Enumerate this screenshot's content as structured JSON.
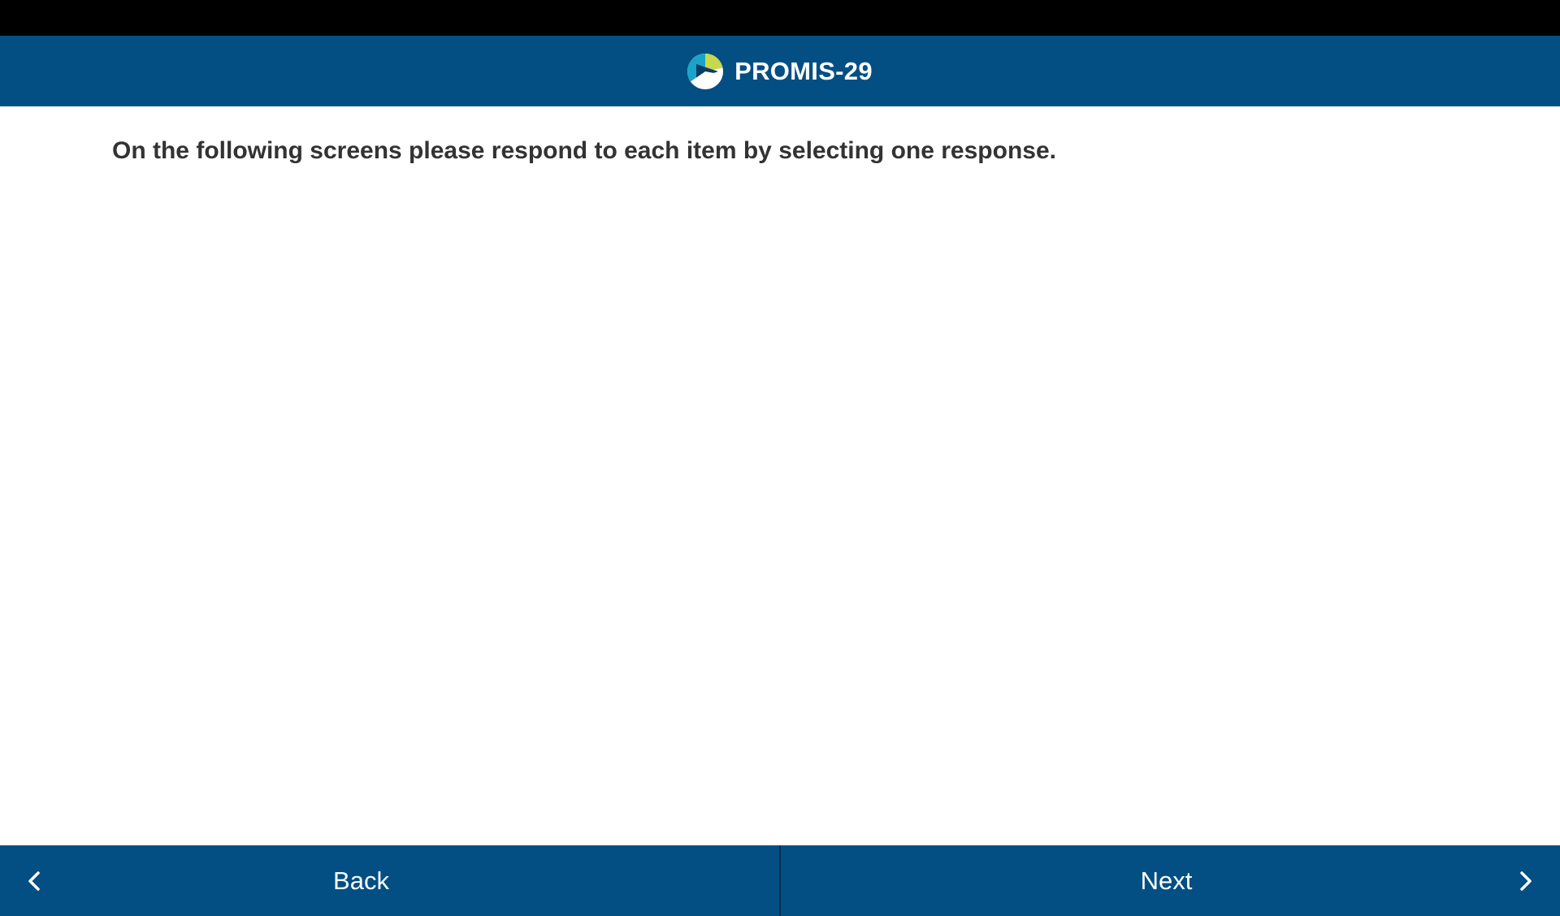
{
  "header": {
    "title": "PROMIS-29",
    "logo_icon": "promis-logo-icon",
    "background": "#034f84"
  },
  "main": {
    "instruction": "On the following screens please respond to each item by selecting one response."
  },
  "footer": {
    "back_label": "Back",
    "next_label": "Next",
    "back_icon": "chevron-left-icon",
    "next_icon": "chevron-right-icon"
  },
  "colors": {
    "primary": "#034f84",
    "logo_green": "#c8d84a",
    "logo_cyan": "#1aa3c8",
    "text": "#333333"
  }
}
